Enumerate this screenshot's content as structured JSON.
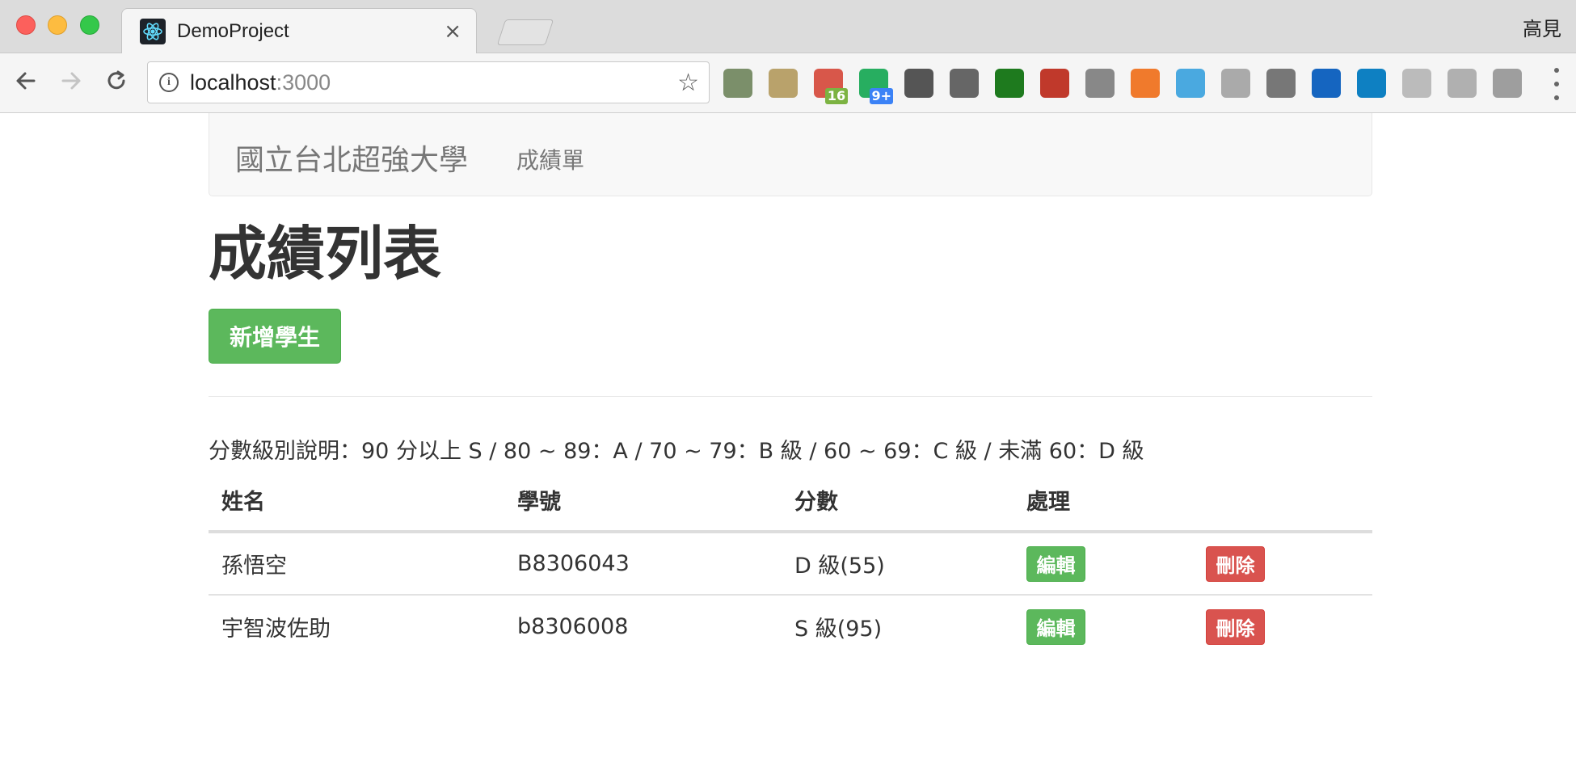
{
  "browser": {
    "tab_title": "DemoProject",
    "tab_close": "×",
    "user_name": "高見",
    "url_host": "localhost",
    "url_port": ":3000",
    "extensions": [
      {
        "name": "ext-1-icon",
        "color": "#7b8f6a",
        "badge": ""
      },
      {
        "name": "ext-2-icon",
        "color": "#b9a26b",
        "badge": ""
      },
      {
        "name": "ext-calendar-icon",
        "color": "#d8574a",
        "badge": "16",
        "badge_color": "#7cb342"
      },
      {
        "name": "ext-4-icon",
        "color": "#27ae60",
        "badge": "9+",
        "badge_color": "#3b82f6"
      },
      {
        "name": "pocket-icon",
        "color": "#555555",
        "badge": ""
      },
      {
        "name": "recycle-icon",
        "color": "#666666",
        "badge": ""
      },
      {
        "name": "bw-icon",
        "color": "#1e7a1e",
        "badge": ""
      },
      {
        "name": "ext-8-icon",
        "color": "#c0392b",
        "badge": ""
      },
      {
        "name": "react-devtools-icon",
        "color": "#888888",
        "badge": ""
      },
      {
        "name": "ext-10-icon",
        "color": "#f07a2c",
        "badge": ""
      },
      {
        "name": "vimeo-icon",
        "color": "#4aa9e0",
        "badge": ""
      },
      {
        "name": "grid-icon",
        "color": "#aaaaaa",
        "badge": ""
      },
      {
        "name": "film-icon",
        "color": "#777777",
        "badge": ""
      },
      {
        "name": "screenshot-icon",
        "color": "#1565c0",
        "badge": ""
      },
      {
        "name": "ext-15-icon",
        "color": "#0e80c2",
        "badge": ""
      },
      {
        "name": "smartpki-icon",
        "color": "#bbbbbb",
        "badge": ""
      },
      {
        "name": "drive-icon",
        "color": "#b0b0b0",
        "badge": ""
      },
      {
        "name": "vue-devtools-icon",
        "color": "#9e9e9e",
        "badge": ""
      }
    ]
  },
  "navbar": {
    "brand": "國立台北超強大學",
    "link": "成績單"
  },
  "main": {
    "heading": "成績列表",
    "add_button": "新增學生",
    "grade_note": "分數級別說明：90 分以上 S / 80 ~ 89：A / 70 ~ 79：B 級 / 60 ~ 69：C 級 / 未滿 60：D 級"
  },
  "table": {
    "headers": [
      "姓名",
      "學號",
      "分數",
      "處理"
    ],
    "rows": [
      {
        "name": "孫悟空",
        "id": "B8306043",
        "score": "D 級(55)",
        "edit": "編輯",
        "delete": "刪除"
      },
      {
        "name": "宇智波佐助",
        "id": "b8306008",
        "score": "S 級(95)",
        "edit": "編輯",
        "delete": "刪除"
      }
    ]
  },
  "colors": {
    "success": "#5cb85c",
    "danger": "#d9534f"
  }
}
